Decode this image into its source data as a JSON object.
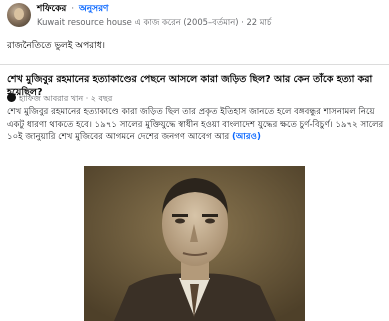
{
  "post": {
    "author": "শফিকের",
    "separator": "·",
    "follow_label": "অনুসরণ",
    "meta": "Kuwait resource house এ কাজ করেন (2005–বর্তমান) · 22 মার্চ",
    "text": "রাজনৈতিতে ভুলই অপরাধ।"
  },
  "answer_card": {
    "question_title": "শেখ মুজিবুর রহমানের হত্যাকাণ্ডের পেছনে আসলে কারা জড়িত ছিল? আর কেন তাঁকে হত্যা করা হয়েছিল?",
    "answerer": "হাফিজ আবরার খান · ২ বছর",
    "body": "শেখ মুজিবুর রহমানের হত্যাকাণ্ডে কারা জড়িত ছিল তার প্রকৃত ইতিহাস জানতে হলে বঙ্গবন্ধুর শাসনামল নিয়ে একটু ধারণা থাকতে হবে। ১৯৭১ সালের মুক্তিযুদ্ধে স্বাধীন হওয়া বাংলাদেশ যুদ্ধের ক্ষতে চুর্ণ-বিচুর্ণ। ১৯৭২ সালের ১০ই জানুয়ারি শেখ মুজিবের আগমনে দেশের জনগণ আবেগ আর",
    "more_label": "(আরও)"
  },
  "icons": {
    "avatar": "author-avatar",
    "answerer": "answerer-avatar"
  },
  "colors": {
    "link": "#0866ff",
    "meta": "#65676b",
    "photo_bg": "#6b5a3c"
  }
}
